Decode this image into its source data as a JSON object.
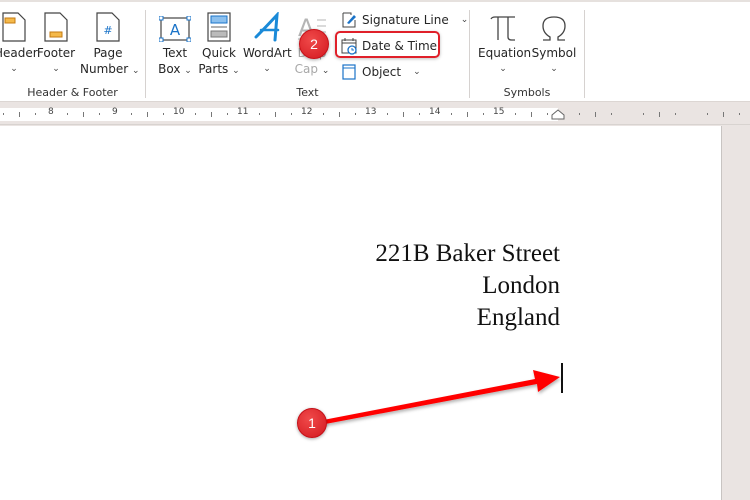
{
  "ribbon": {
    "groups": {
      "header_footer": {
        "label": "Header & Footer",
        "buttons": [
          {
            "label": "Header",
            "icon": "header-icon"
          },
          {
            "label": "Footer",
            "icon": "footer-icon"
          },
          {
            "label_line1": "Page",
            "label_line2": "Number",
            "icon": "page-number-icon"
          }
        ]
      },
      "text": {
        "label": "Text",
        "text_box": {
          "line1": "Text",
          "line2": "Box"
        },
        "quick_parts": {
          "line1": "Quick",
          "line2": "Parts"
        },
        "wordart": {
          "line1": "WordArt"
        },
        "drop_cap": {
          "line1": "Drop",
          "line2": "Cap"
        },
        "signature_line": "Signature Line",
        "date_time": "Date & Time",
        "object": "Object"
      },
      "symbols": {
        "label": "Symbols",
        "equation": "Equation",
        "symbol": "Symbol"
      }
    },
    "chevron": "⌄"
  },
  "ruler": {
    "numbers": [
      "8",
      "9",
      "10",
      "11",
      "12",
      "13",
      "14",
      "15"
    ]
  },
  "document": {
    "address_lines": [
      "221B Baker Street",
      "London",
      "England"
    ]
  },
  "annotations": {
    "step1": "1",
    "step2": "2",
    "color": "#e0202a"
  }
}
